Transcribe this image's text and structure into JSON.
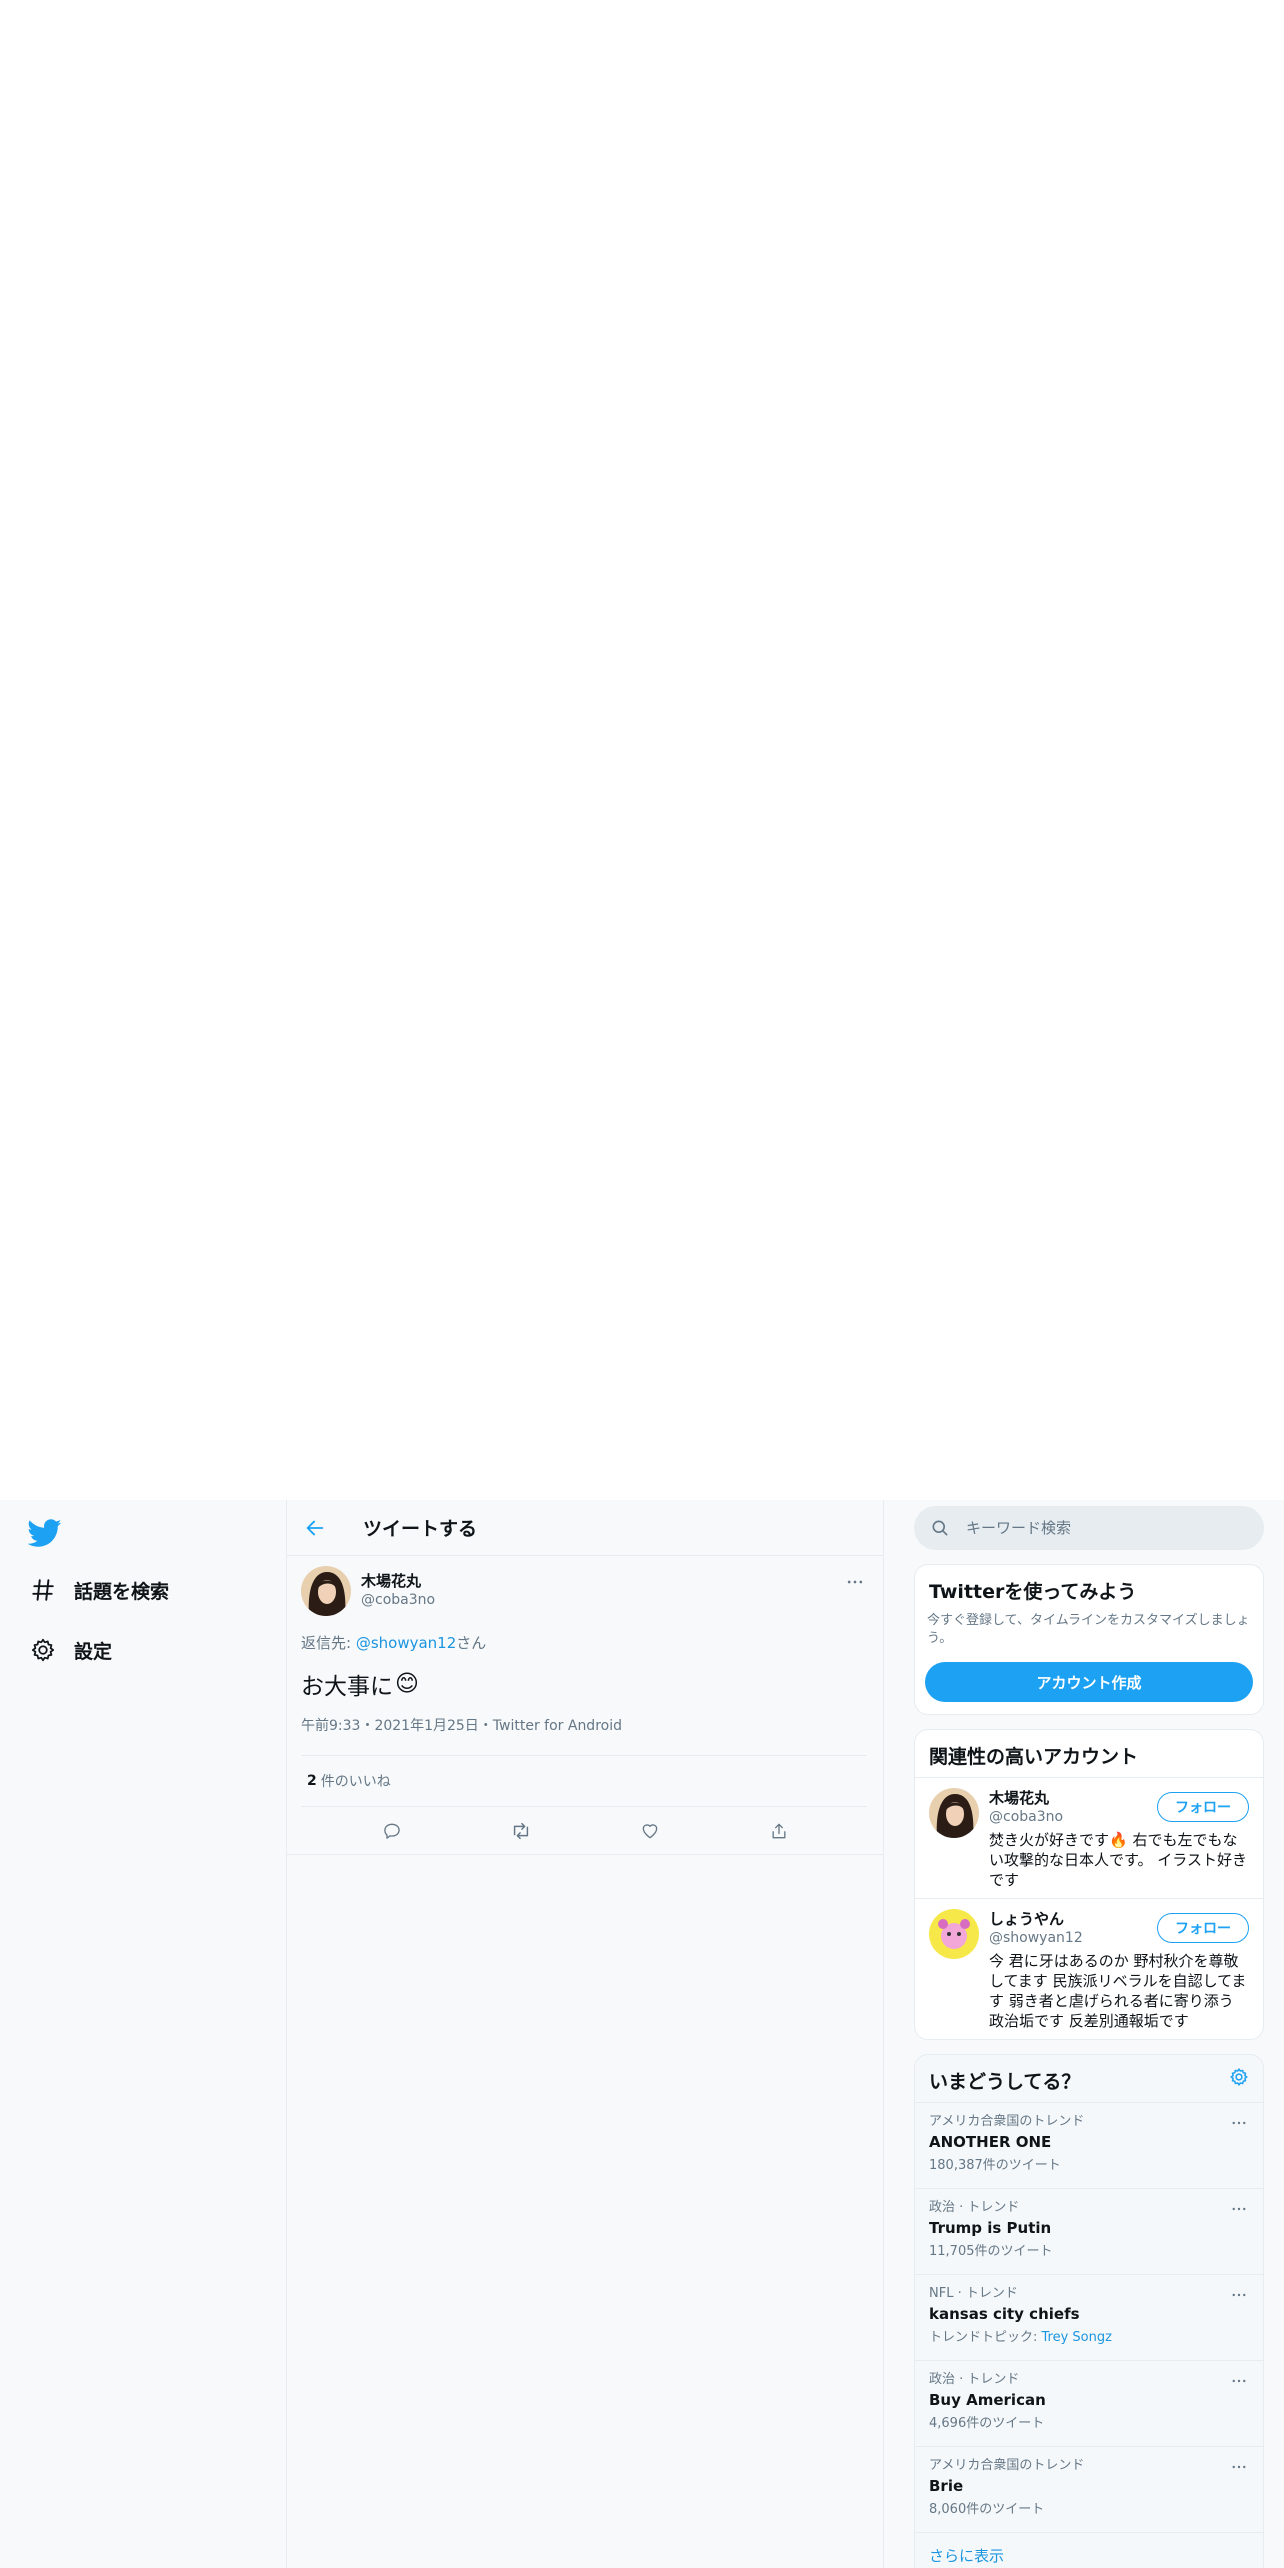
{
  "nav": {
    "items": [
      {
        "label": "話題を検索",
        "icon": "hashtag-icon"
      },
      {
        "label": "設定",
        "icon": "gear-icon"
      }
    ]
  },
  "header": {
    "title": "ツイートする"
  },
  "tweet": {
    "author_name": "木場花丸",
    "author_handle": "@coba3no",
    "reply_prefix": "返信先: ",
    "reply_handle": "@showyan12",
    "reply_suffix": "さん",
    "text": "お大事に",
    "emoji": "😊",
    "meta": "午前9:33・2021年1月25日・Twitter for Android",
    "likes_count": "2",
    "likes_label": "件のいいね"
  },
  "search": {
    "placeholder": "キーワード検索"
  },
  "signup": {
    "title": "Twitterを使ってみよう",
    "desc": "今すぐ登録して、タイムラインをカスタマイズしましょう。",
    "button": "アカウント作成"
  },
  "related": {
    "title": "関連性の高いアカウント",
    "follow_label": "フォロー",
    "accounts": [
      {
        "name": "木場花丸",
        "handle": "@coba3no",
        "bio": "焚き火が好きです🔥 右でも左でもない攻撃的な日本人です。 イラスト好きです"
      },
      {
        "name": "しょうやん",
        "handle": "@showyan12",
        "bio": "今 君に牙はあるのか 野村秋介を尊敬してます 民族派リベラルを自認してます 弱き者と虐げられる者に寄り添う 政治垢です 反差別通報垢です"
      }
    ]
  },
  "trends": {
    "title": "いまどうしてる？",
    "items": [
      {
        "context": "アメリカ合衆国のトレンド",
        "name": "ANOTHER ONE",
        "count": "180,387件のツイート",
        "link": ""
      },
      {
        "context": "政治 · トレンド",
        "name": "Trump is Putin",
        "count": "11,705件のツイート",
        "link": ""
      },
      {
        "context": "NFL · トレンド",
        "name": "kansas city chiefs",
        "count": "トレンドトピック: ",
        "link": "Trey Songz"
      },
      {
        "context": "政治 · トレンド",
        "name": "Buy American",
        "count": "4,696件のツイート",
        "link": ""
      },
      {
        "context": "アメリカ合衆国のトレンド",
        "name": "Brie",
        "count": "8,060件のツイート",
        "link": ""
      }
    ],
    "show_more": "さらに表示"
  },
  "colors": {
    "accent": "#1da1f2",
    "link": "#1b95e0",
    "muted": "#657786"
  }
}
